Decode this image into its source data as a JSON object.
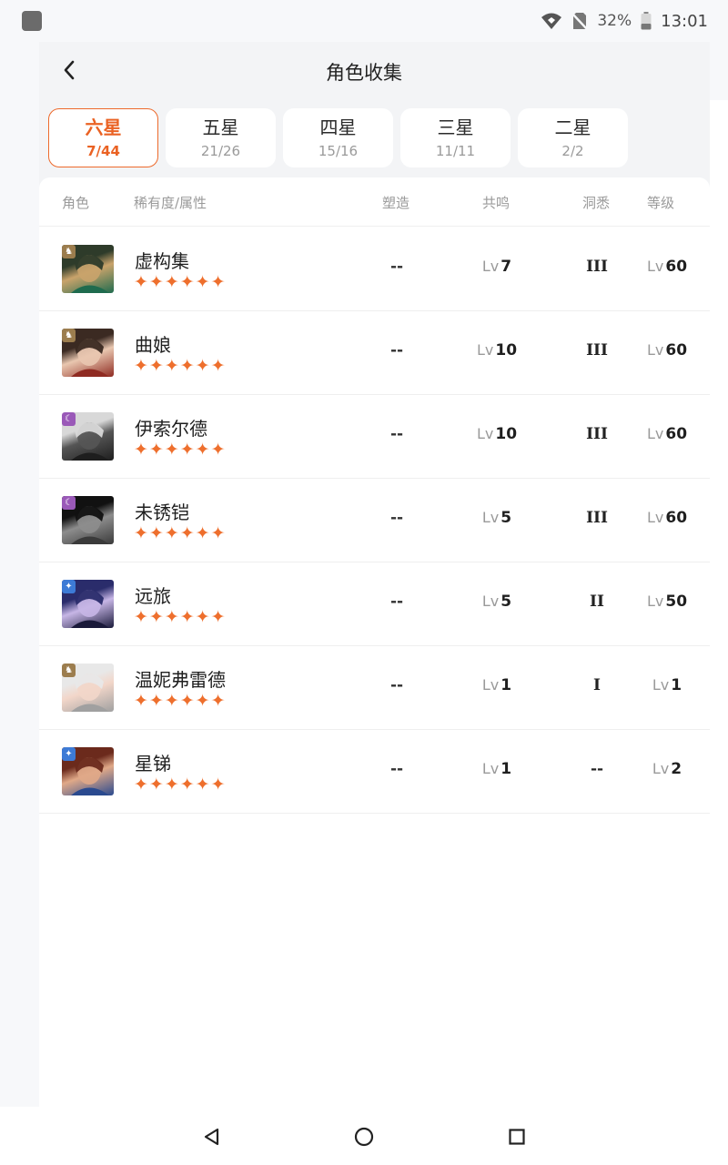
{
  "status_bar": {
    "battery": "32%",
    "time": "13:01"
  },
  "header": {
    "title": "角色收集"
  },
  "tabs": [
    {
      "label": "六星",
      "count": "7/44",
      "active": true
    },
    {
      "label": "五星",
      "count": "21/26",
      "active": false
    },
    {
      "label": "四星",
      "count": "15/16",
      "active": false
    },
    {
      "label": "三星",
      "count": "11/11",
      "active": false
    },
    {
      "label": "二星",
      "count": "2/2",
      "active": false
    }
  ],
  "table": {
    "headers": {
      "role": "角色",
      "rarity": "稀有度/属性",
      "mold": "塑造",
      "resonance": "共鸣",
      "insight": "洞悉",
      "level": "等级"
    },
    "lv_prefix": "Lv",
    "rows": [
      {
        "name": "虚构集",
        "stars": "✦✦✦✦✦✦",
        "mold": "--",
        "resonance": "7",
        "insight": "III",
        "level": "60",
        "attr": "beast-icon",
        "attr_color": "#9c7d4e",
        "avatar_colors": [
          "#2e3b2a",
          "#c9a36b",
          "#1f6b4e"
        ]
      },
      {
        "name": "曲娘",
        "stars": "✦✦✦✦✦✦",
        "mold": "--",
        "resonance": "10",
        "insight": "III",
        "level": "60",
        "attr": "beast-icon",
        "attr_color": "#9c7d4e",
        "avatar_colors": [
          "#3b2a22",
          "#e9c7b0",
          "#8f2b22"
        ]
      },
      {
        "name": "伊索尔德",
        "stars": "✦✦✦✦✦✦",
        "mold": "--",
        "resonance": "10",
        "insight": "III",
        "level": "60",
        "attr": "spirit-icon",
        "attr_color": "#9a59b8",
        "avatar_colors": [
          "#d8d8d8",
          "#555555",
          "#1e1e1e"
        ]
      },
      {
        "name": "未锈铠",
        "stars": "✦✦✦✦✦✦",
        "mold": "--",
        "resonance": "5",
        "insight": "III",
        "level": "60",
        "attr": "spirit-icon",
        "attr_color": "#9a59b8",
        "avatar_colors": [
          "#111111",
          "#8d8d8d",
          "#3a3a3a"
        ]
      },
      {
        "name": "远旅",
        "stars": "✦✦✦✦✦✦",
        "mold": "--",
        "resonance": "5",
        "insight": "II",
        "level": "50",
        "attr": "star-icon",
        "attr_color": "#3d7bd6",
        "avatar_colors": [
          "#2a2c6b",
          "#c7b6e6",
          "#1a1a3a"
        ]
      },
      {
        "name": "温妮弗雷德",
        "stars": "✦✦✦✦✦✦",
        "mold": "--",
        "resonance": "1",
        "insight": "I",
        "level": "1",
        "attr": "beast-icon",
        "attr_color": "#9c7d4e",
        "avatar_colors": [
          "#e8e8e8",
          "#f2d6c9",
          "#a0a0a0"
        ]
      },
      {
        "name": "星锑",
        "stars": "✦✦✦✦✦✦",
        "mold": "--",
        "resonance": "1",
        "insight": "--",
        "level": "2",
        "attr": "star-icon",
        "attr_color": "#3d7bd6",
        "avatar_colors": [
          "#6b2a1c",
          "#e0a988",
          "#2a4a8f"
        ]
      }
    ]
  }
}
